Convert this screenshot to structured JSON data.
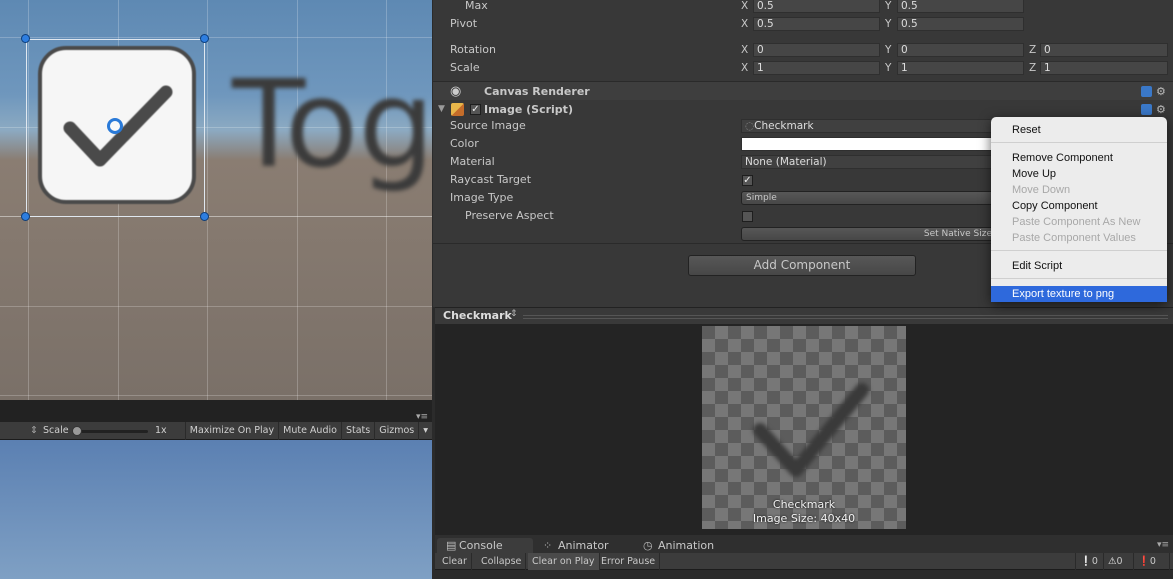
{
  "scene": {
    "toggle_label": "Tog"
  },
  "game_toolbar": {
    "scale_label": "Scale",
    "scale_value": "1x",
    "maximize_on_play": "Maximize On Play",
    "mute_audio": "Mute Audio",
    "stats": "Stats",
    "gizmos": "Gizmos"
  },
  "inspector": {
    "anchors": {
      "max_label": "Max",
      "max_x": "0.5",
      "max_y": "0.5",
      "pivot_label": "Pivot",
      "pivot_x": "0.5",
      "pivot_y": "0.5"
    },
    "rotation": {
      "label": "Rotation",
      "x": "0",
      "y": "0",
      "z": "0"
    },
    "scale": {
      "label": "Scale",
      "x": "1",
      "y": "1",
      "z": "1"
    },
    "axis": {
      "x": "X",
      "y": "Y",
      "z": "Z"
    },
    "canvas_renderer": {
      "title": "Canvas Renderer"
    },
    "image_script": {
      "title": "Image (Script)",
      "source_image_label": "Source Image",
      "source_image_value": "Checkmark",
      "color_label": "Color",
      "material_label": "Material",
      "material_value": "None (Material)",
      "raycast_label": "Raycast Target",
      "image_type_label": "Image Type",
      "image_type_value": "Simple",
      "preserve_aspect_label": "Preserve Aspect",
      "set_native_size": "Set Native Size"
    },
    "add_component": "Add Component"
  },
  "preview": {
    "title": "Checkmark",
    "asset_name": "Checkmark",
    "image_size": "Image Size: 40x40"
  },
  "console": {
    "tabs": [
      "Console",
      "Animator",
      "Animation"
    ],
    "clear": "Clear",
    "collapse": "Collapse",
    "clear_on_play": "Clear on Play",
    "error_pause": "Error Pause",
    "count_info": "0",
    "count_warn": "0",
    "count_err": "0"
  },
  "context_menu": {
    "items": [
      {
        "label": "Reset",
        "enabled": true
      },
      {
        "label": "Remove Component",
        "enabled": true
      },
      {
        "label": "Move Up",
        "enabled": true
      },
      {
        "label": "Move Down",
        "enabled": false
      },
      {
        "label": "Copy Component",
        "enabled": true
      },
      {
        "label": "Paste Component As New",
        "enabled": false
      },
      {
        "label": "Paste Component Values",
        "enabled": false
      },
      {
        "label": "Edit Script",
        "enabled": true
      },
      {
        "label": "Export texture to png",
        "enabled": true,
        "highlighted": true
      }
    ]
  },
  "colors": {
    "selection_blue": "#2e69dc",
    "handle_blue": "#2e7ee0",
    "panel_dark": "#383838"
  }
}
